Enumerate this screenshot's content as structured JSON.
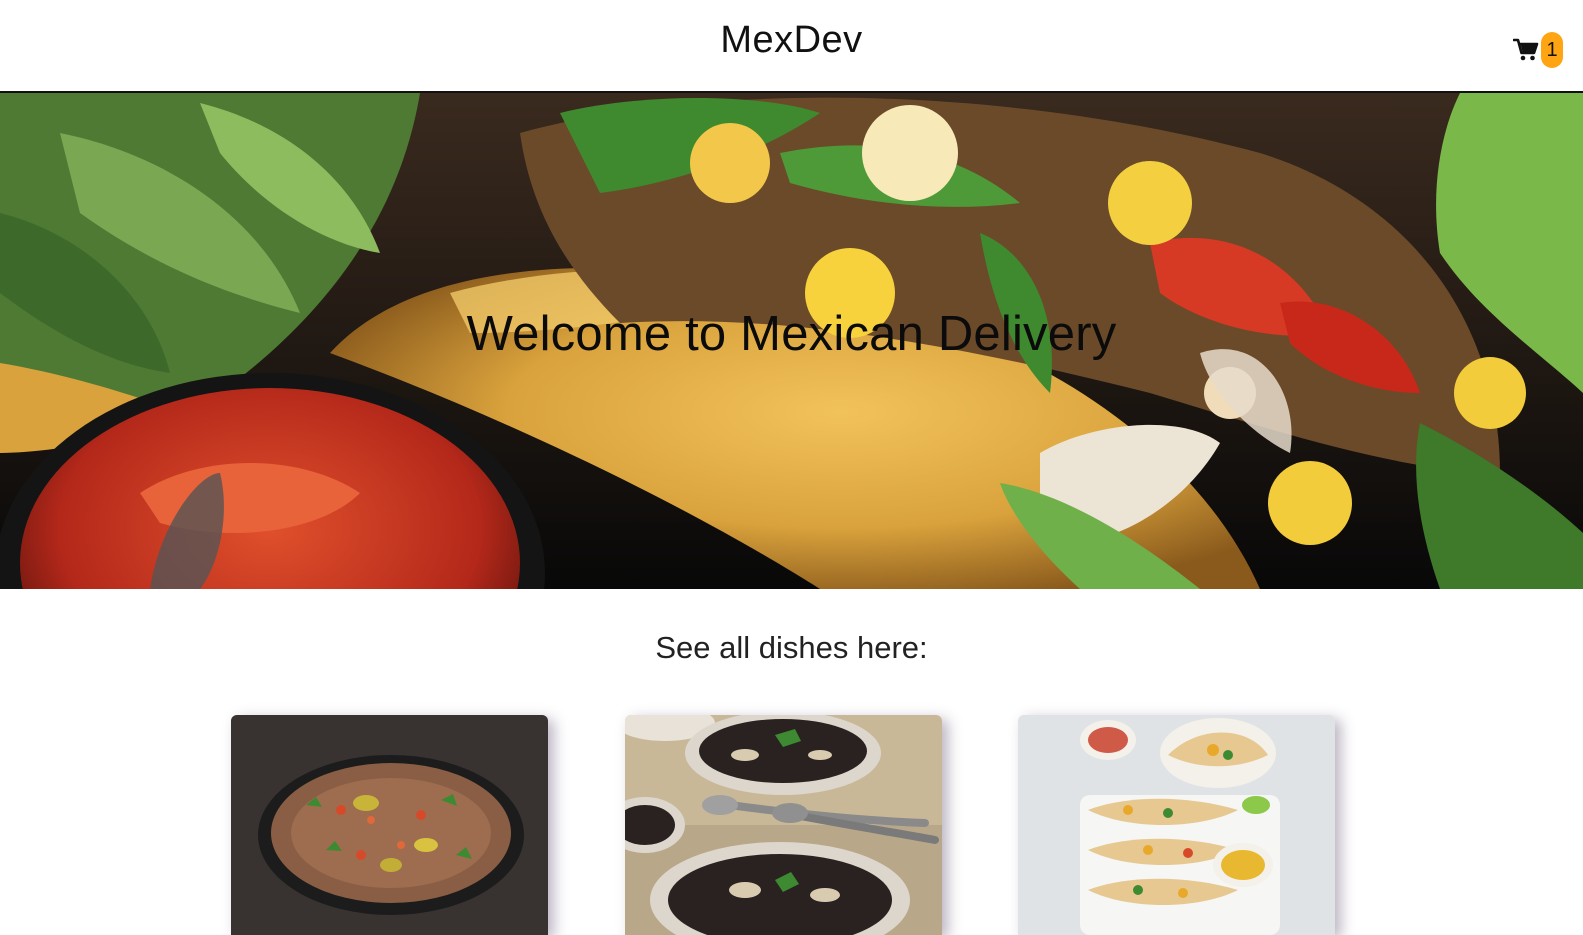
{
  "header": {
    "brand": "MexDev",
    "cart": {
      "icon": "cart-icon",
      "count": "1",
      "badge_color": "#ffa412"
    }
  },
  "hero": {
    "title": "Welcome to Mexican Delivery",
    "image": "taco-hero-image"
  },
  "dishes": {
    "heading": "See all dishes here:",
    "items": [
      {
        "image": "refried-beans-dish-image"
      },
      {
        "image": "black-bean-soup-dish-image"
      },
      {
        "image": "fish-tacos-dish-image"
      }
    ]
  }
}
